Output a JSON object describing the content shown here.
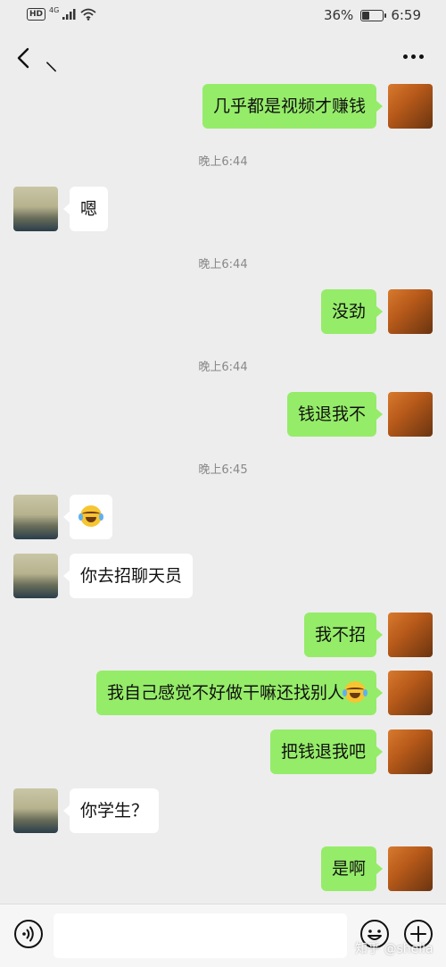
{
  "status_bar": {
    "hd": "HD",
    "network": "4G",
    "battery": "36%",
    "battery_level": 0.36,
    "time": "6:59"
  },
  "header": {
    "title": "⸜",
    "back_icon": "chevron-left-icon",
    "more_icon": "more-dots-icon"
  },
  "messages": [
    {
      "from": "me",
      "text": "几乎都是视频才赚钱"
    },
    {
      "type": "time",
      "text": "晚上6:44"
    },
    {
      "from": "them",
      "text": "嗯"
    },
    {
      "type": "time",
      "text": "晚上6:44"
    },
    {
      "from": "me",
      "text": "没劲"
    },
    {
      "type": "time",
      "text": "晚上6:44"
    },
    {
      "from": "me",
      "text": "钱退我不"
    },
    {
      "type": "time",
      "text": "晚上6:45"
    },
    {
      "from": "them",
      "text": "",
      "emoji": "tears-of-joy-emoji"
    },
    {
      "from": "them",
      "text": "你去招聊天员"
    },
    {
      "from": "me",
      "text": "我不招"
    },
    {
      "from": "me",
      "text": "我自己感觉不好做干嘛还找别人",
      "emoji": "tears-of-joy-emoji"
    },
    {
      "from": "me",
      "text": "把钱退我吧"
    },
    {
      "from": "them",
      "text": "你学生？"
    },
    {
      "from": "me",
      "text": "是啊"
    }
  ],
  "input_bar": {
    "voice_icon": "voice-icon",
    "placeholder": "",
    "emoji_icon": "emoji-icon",
    "plus_icon": "plus-icon"
  },
  "watermark": "知乎 @shella",
  "colors": {
    "background": "#ededed",
    "my_bubble": "#95ec69",
    "their_bubble": "#ffffff"
  }
}
